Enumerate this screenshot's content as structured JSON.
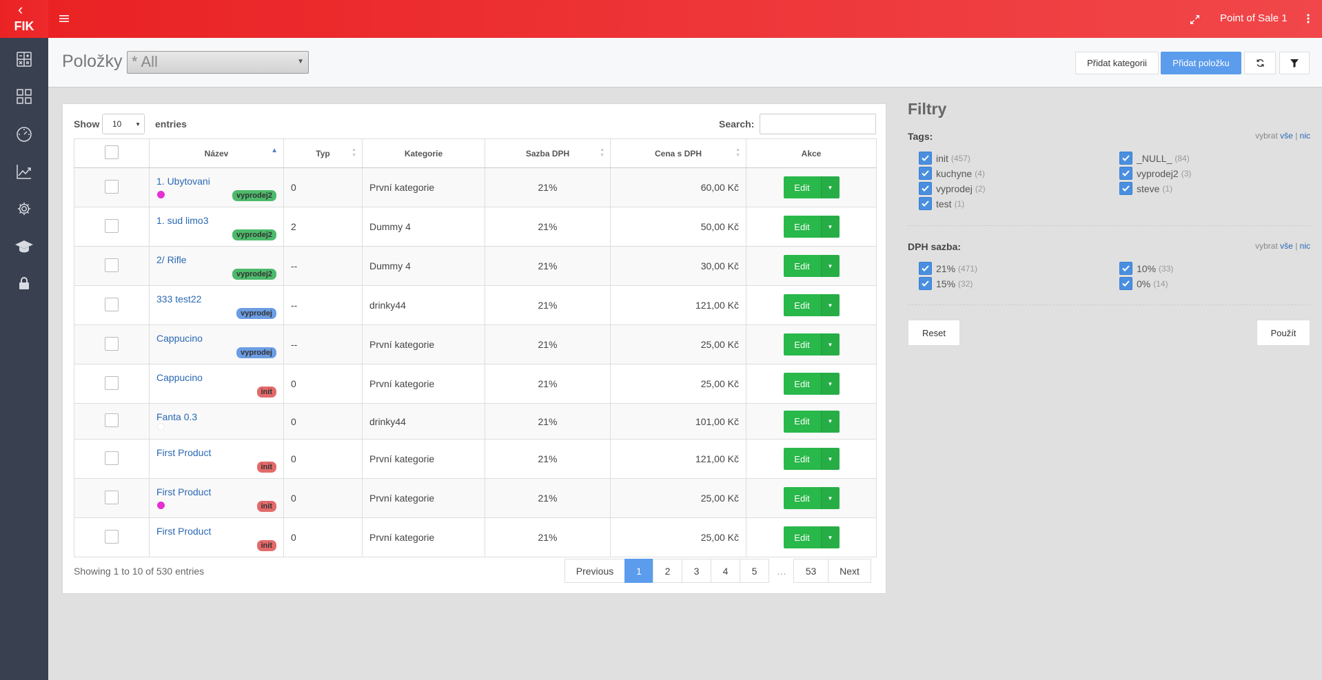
{
  "brand": {
    "logo_text": "FIK",
    "back_glyph": "‹"
  },
  "topbar": {
    "pos_name": "Point of Sale 1"
  },
  "sidebar": {
    "icons": [
      "calculator-icon",
      "dashboard-grid-icon",
      "speedometer-icon",
      "chart-line-icon",
      "gear-icon",
      "graduation-cap-icon",
      "lock-icon"
    ]
  },
  "header": {
    "title": "Položky",
    "category_select": "* All",
    "add_category": "Přidat kategorii",
    "add_item": "Přidat položku"
  },
  "table_controls": {
    "show": "Show",
    "page_length": "10",
    "entries": "entries",
    "search": "Search:"
  },
  "columns": {
    "name": "Název",
    "type": "Typ",
    "category": "Kategorie",
    "vat": "Sazba DPH",
    "price": "Cena s DPH",
    "actions": "Akce"
  },
  "rows": [
    {
      "name": "1. Ubytovani",
      "tag": "vyprodej2",
      "tag_color": "green",
      "dot": "magenta",
      "type": "0",
      "category": "První kategorie",
      "vat": "21%",
      "price": "60,00 Kč",
      "edit": "Edit"
    },
    {
      "name": "1. sud limo3",
      "tag": "vyprodej2",
      "tag_color": "green",
      "dot": "",
      "type": "2",
      "category": "Dummy 4",
      "vat": "21%",
      "price": "50,00 Kč",
      "edit": "Edit"
    },
    {
      "name": "2/ Rifle",
      "tag": "vyprodej2",
      "tag_color": "green",
      "dot": "",
      "type": "--",
      "category": "Dummy 4",
      "vat": "21%",
      "price": "30,00 Kč",
      "edit": "Edit"
    },
    {
      "name": "333 test22",
      "tag": "vyprodej",
      "tag_color": "blue",
      "dot": "",
      "type": "--",
      "category": "drinky44",
      "vat": "21%",
      "price": "121,00 Kč",
      "edit": "Edit"
    },
    {
      "name": "Cappucino",
      "tag": "vyprodej",
      "tag_color": "blue",
      "dot": "",
      "type": "--",
      "category": "První kategorie",
      "vat": "21%",
      "price": "25,00 Kč",
      "edit": "Edit"
    },
    {
      "name": "Cappucino",
      "tag": "init",
      "tag_color": "red",
      "dot": "",
      "type": "0",
      "category": "První kategorie",
      "vat": "21%",
      "price": "25,00 Kč",
      "edit": "Edit"
    },
    {
      "name": "Fanta 0.3",
      "tag": "",
      "tag_color": "",
      "dot": "white",
      "type": "0",
      "category": "drinky44",
      "vat": "21%",
      "price": "101,00 Kč",
      "edit": "Edit"
    },
    {
      "name": "First Product",
      "tag": "init",
      "tag_color": "red",
      "dot": "",
      "type": "0",
      "category": "První kategorie",
      "vat": "21%",
      "price": "121,00 Kč",
      "edit": "Edit"
    },
    {
      "name": "First Product",
      "tag": "init",
      "tag_color": "red",
      "dot": "magenta",
      "type": "0",
      "category": "První kategorie",
      "vat": "21%",
      "price": "25,00 Kč",
      "edit": "Edit"
    },
    {
      "name": "First Product",
      "tag": "init",
      "tag_color": "red",
      "dot": "",
      "type": "0",
      "category": "První kategorie",
      "vat": "21%",
      "price": "25,00 Kč",
      "edit": "Edit"
    }
  ],
  "info": "Showing 1 to 10 of 530 entries",
  "pagination": {
    "previous": "Previous",
    "pages": [
      "1",
      "2",
      "3",
      "4",
      "5"
    ],
    "ellipsis": "…",
    "last": "53",
    "next": "Next",
    "active": "1"
  },
  "filters": {
    "title": "Filtry",
    "tags_label": "Tags",
    "select_prefix": "vybrat",
    "select_all": "vše",
    "separator": "|",
    "select_none": "nic",
    "tags": [
      {
        "name": "init",
        "count": "(457)"
      },
      {
        "name": "_NULL_",
        "count": "(84)"
      },
      {
        "name": "kuchyne",
        "count": "(4)"
      },
      {
        "name": "vyprodej2",
        "count": "(3)"
      },
      {
        "name": "vyprodej",
        "count": "(2)"
      },
      {
        "name": "steve",
        "count": "(1)"
      },
      {
        "name": "test",
        "count": "(1)"
      }
    ],
    "vat_label": "DPH sazba",
    "vat_rates": [
      {
        "name": "21%",
        "count": "(471)"
      },
      {
        "name": "10%",
        "count": "(33)"
      },
      {
        "name": "15%",
        "count": "(32)"
      },
      {
        "name": "0%",
        "count": "(14)"
      }
    ],
    "reset": "Reset",
    "apply": "Použít"
  },
  "colors": {
    "primary_red": "#ea2224",
    "sidebar": "#39404f",
    "accent_blue": "#5b9cec",
    "edit_green": "#29b84a"
  }
}
